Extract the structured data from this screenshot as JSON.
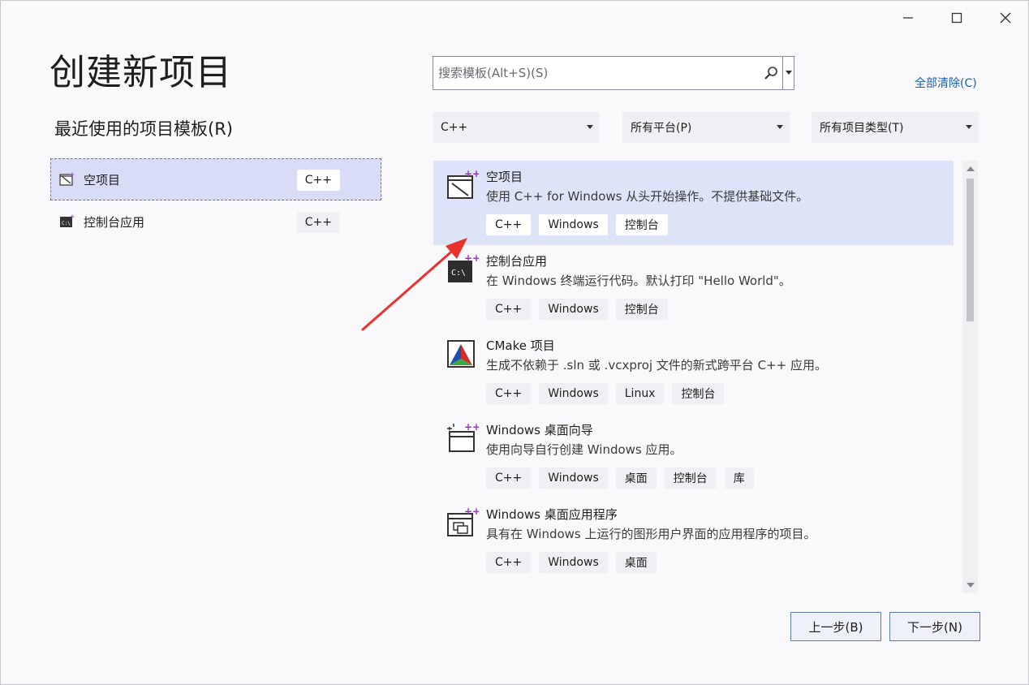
{
  "window": {
    "title": "创建新项目",
    "controls": [
      "minimize-icon",
      "maximize-icon",
      "close-icon"
    ]
  },
  "recent": {
    "title": "最近使用的项目模板(R)",
    "items": [
      {
        "label": "空项目",
        "tag": "C++",
        "icon": "empty-project-icon",
        "selected": true
      },
      {
        "label": "控制台应用",
        "tag": "C++",
        "icon": "console-app-icon",
        "selected": false
      }
    ]
  },
  "search": {
    "placeholder": "搜索模板(Alt+S)(S)",
    "value": "",
    "icon": "search-icon"
  },
  "clear_all": "全部清除(C)",
  "filters": {
    "language": "C++",
    "platform": "所有平台(P)",
    "project_type": "所有项目类型(T)"
  },
  "templates": [
    {
      "name": "空项目",
      "description": "使用 C++ for Windows 从头开始操作。不提供基础文件。",
      "tags": [
        "C++",
        "Windows",
        "控制台"
      ],
      "icon": "empty-project-icon",
      "selected": true
    },
    {
      "name": "控制台应用",
      "description": "在 Windows 终端运行代码。默认打印 \"Hello World\"。",
      "tags": [
        "C++",
        "Windows",
        "控制台"
      ],
      "icon": "console-app-icon",
      "selected": false
    },
    {
      "name": "CMake 项目",
      "description": "生成不依赖于 .sln 或 .vcxproj 文件的新式跨平台 C++ 应用。",
      "tags": [
        "C++",
        "Windows",
        "Linux",
        "控制台"
      ],
      "icon": "cmake-icon",
      "selected": false
    },
    {
      "name": "Windows 桌面向导",
      "description": "使用向导自行创建 Windows 应用。",
      "tags": [
        "C++",
        "Windows",
        "桌面",
        "控制台",
        "库"
      ],
      "icon": "desktop-wizard-icon",
      "selected": false
    },
    {
      "name": "Windows 桌面应用程序",
      "description": "具有在 Windows 上运行的图形用户界面的应用程序的项目。",
      "tags": [
        "C++",
        "Windows",
        "桌面"
      ],
      "icon": "desktop-app-icon",
      "selected": false
    }
  ],
  "buttons": {
    "back": "上一步(B)",
    "next": "下一步(N)"
  },
  "colors": {
    "accent": "#1a5fb4",
    "selected_bg": "#dde4f8",
    "arrow": "#e8322d"
  }
}
